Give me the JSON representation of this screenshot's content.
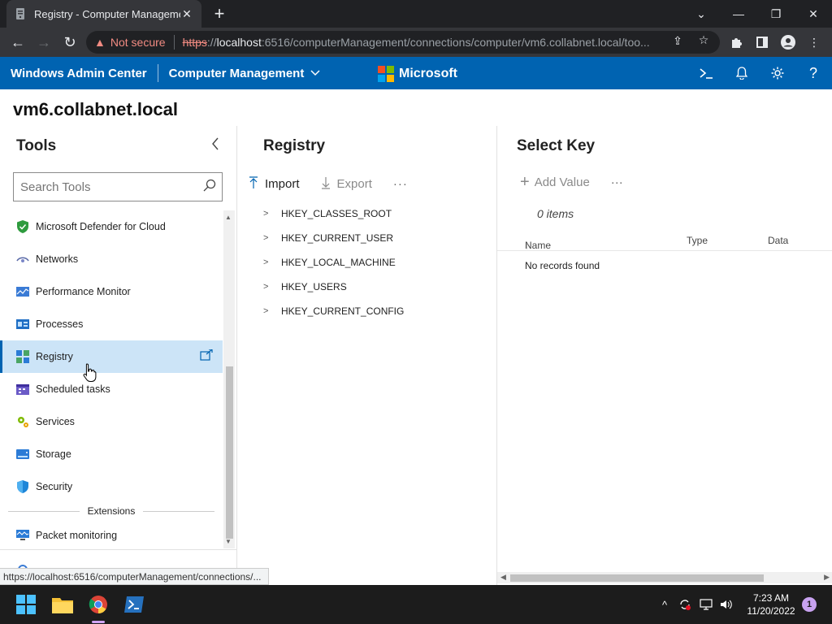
{
  "browser": {
    "tab_title": "Registry - Computer Management",
    "tab_close": "✕",
    "new_tab": "+",
    "window_controls": {
      "minimize": "—",
      "maximize": "❐",
      "close": "✕",
      "tab_search": "⌄"
    },
    "security_label": "Not secure",
    "url_scheme": "https",
    "url_host": "localhost",
    "url_rest": ":6516/computerManagement/connections/computer/vm6.collabnet.local/too..."
  },
  "wac": {
    "title": "Windows Admin Center",
    "context": "Computer Management",
    "brand": "Microsoft",
    "brand_colors": [
      "#f25022",
      "#7fba00",
      "#00a4ef",
      "#ffb900"
    ],
    "accent": "#0063b1"
  },
  "server": {
    "name": "vm6.collabnet.local"
  },
  "tools": {
    "heading": "Tools",
    "search_placeholder": "Search Tools",
    "items": [
      {
        "label": "Microsoft Defender for Cloud",
        "icon": "shield-check-icon"
      },
      {
        "label": "Networks",
        "icon": "network-icon"
      },
      {
        "label": "Performance Monitor",
        "icon": "performance-monitor-icon"
      },
      {
        "label": "Processes",
        "icon": "processes-icon"
      },
      {
        "label": "Registry",
        "icon": "registry-icon",
        "active": true
      },
      {
        "label": "Scheduled tasks",
        "icon": "scheduled-tasks-icon"
      },
      {
        "label": "Services",
        "icon": "services-gear-icon"
      },
      {
        "label": "Storage",
        "icon": "storage-icon"
      },
      {
        "label": "Security",
        "icon": "security-shield-icon"
      }
    ],
    "extensions_label": "Extensions",
    "extension_items": [
      {
        "label": "Packet monitoring",
        "icon": "packet-monitoring-icon"
      }
    ]
  },
  "registry": {
    "heading": "Registry",
    "import_label": "Import",
    "export_label": "Export",
    "more": "···",
    "hives": [
      "HKEY_CLASSES_ROOT",
      "HKEY_CURRENT_USER",
      "HKEY_LOCAL_MACHINE",
      "HKEY_USERS",
      "HKEY_CURRENT_CONFIG"
    ]
  },
  "key": {
    "heading": "Select Key",
    "add_value_label": "Add Value",
    "more": "···",
    "items_count": "0 items",
    "columns": {
      "name": "Name",
      "type": "Type",
      "data": "Data"
    },
    "empty_message": "No records found"
  },
  "status_bar": {
    "link": "https://localhost:6516/computerManagement/connections/..."
  },
  "taskbar": {
    "time": "7:23 AM",
    "date": "11/20/2022",
    "notification_count": "1"
  }
}
